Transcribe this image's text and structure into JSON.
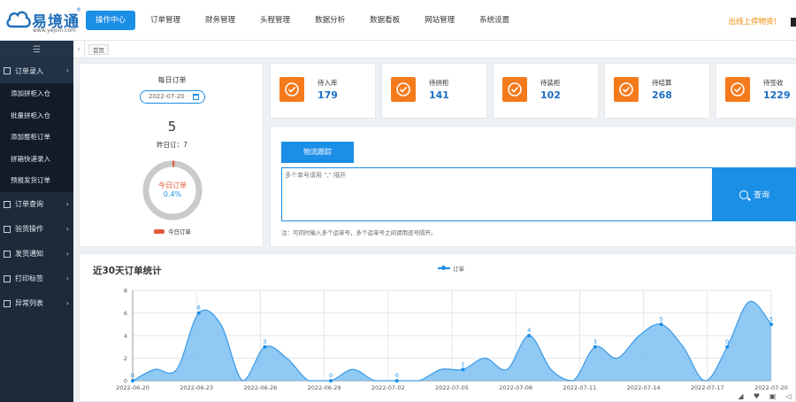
{
  "header": {
    "logo_text": "易境通",
    "logo_url": "www.yejoin.com",
    "logo_mark": "®",
    "nav": [
      "操作中心",
      "订单管理",
      "财务管理",
      "头程管理",
      "数据分析",
      "数据看板",
      "网站管理",
      "系统设置"
    ],
    "promo": "出线上停物资!"
  },
  "sidebar": {
    "menu_icon": "menu-icon",
    "groups": [
      {
        "label": "订单录入",
        "items": [
          "添加拼柜入仓",
          "批量拼柜入仓",
          "添加整柜订单",
          "拼箱快递录入",
          "预报发货订单"
        ]
      },
      {
        "label": "订单查询",
        "items": []
      },
      {
        "label": "验货操作",
        "items": []
      },
      {
        "label": "发货通知",
        "items": []
      },
      {
        "label": "打印标签",
        "items": []
      },
      {
        "label": "异常列表",
        "items": []
      }
    ]
  },
  "tabs": {
    "home": "首页"
  },
  "daily": {
    "title": "每日订单",
    "date": "2022-07-20",
    "count": "5",
    "yesterday": "昨日订：7",
    "donut_label": "今日订单",
    "donut_value": "0.4%",
    "donut_fraction": 0.004,
    "legend": "今日订单"
  },
  "stats": [
    {
      "label": "待入库",
      "value": "179"
    },
    {
      "label": "待拼柜",
      "value": "141"
    },
    {
      "label": "待装柜",
      "value": "102"
    },
    {
      "label": "待结算",
      "value": "268"
    },
    {
      "label": "待签收",
      "value": "1229"
    }
  ],
  "tracking": {
    "button": "物流跟踪",
    "placeholder": "多个单号请用 \",\" 隔开",
    "search": "查询",
    "note": "注：可同时输入多个运单号，多个运单号之间请用逗号隔开。"
  },
  "colors": {
    "primary": "#1b8ee6",
    "orange": "#f57a1c",
    "sidebar": "#1c2a3a"
  },
  "chart_data": {
    "type": "area",
    "title": "近30天订单统计",
    "series_name": "订单",
    "x_ticks": [
      "2022-06-20",
      "2022-06-23",
      "2022-06-26",
      "2022-06-29",
      "2022-07-02",
      "2022-07-05",
      "2022-07-08",
      "2022-07-11",
      "2022-07-14",
      "2022-07-17",
      "2022-07-20"
    ],
    "y_ticks": [
      0,
      2,
      4,
      6,
      8
    ],
    "ylim": [
      0,
      8
    ],
    "values": [
      0,
      1,
      1,
      6,
      5,
      0,
      3,
      2,
      0,
      0,
      1,
      0,
      0,
      0,
      1,
      1,
      2,
      1,
      4,
      1,
      0,
      3,
      2,
      4,
      5,
      3,
      0,
      3,
      7,
      5
    ],
    "labels": [
      {
        "index": 0,
        "text": "0"
      },
      {
        "index": 3,
        "text": "6"
      },
      {
        "index": 6,
        "text": "3"
      },
      {
        "index": 9,
        "text": "0"
      },
      {
        "index": 12,
        "text": "0"
      },
      {
        "index": 15,
        "text": "1"
      },
      {
        "index": 18,
        "text": "4"
      },
      {
        "index": 21,
        "text": "3"
      },
      {
        "index": 24,
        "text": "5"
      },
      {
        "index": 27,
        "text": "0"
      },
      {
        "index": 29,
        "text": "5"
      }
    ],
    "grid": true
  }
}
